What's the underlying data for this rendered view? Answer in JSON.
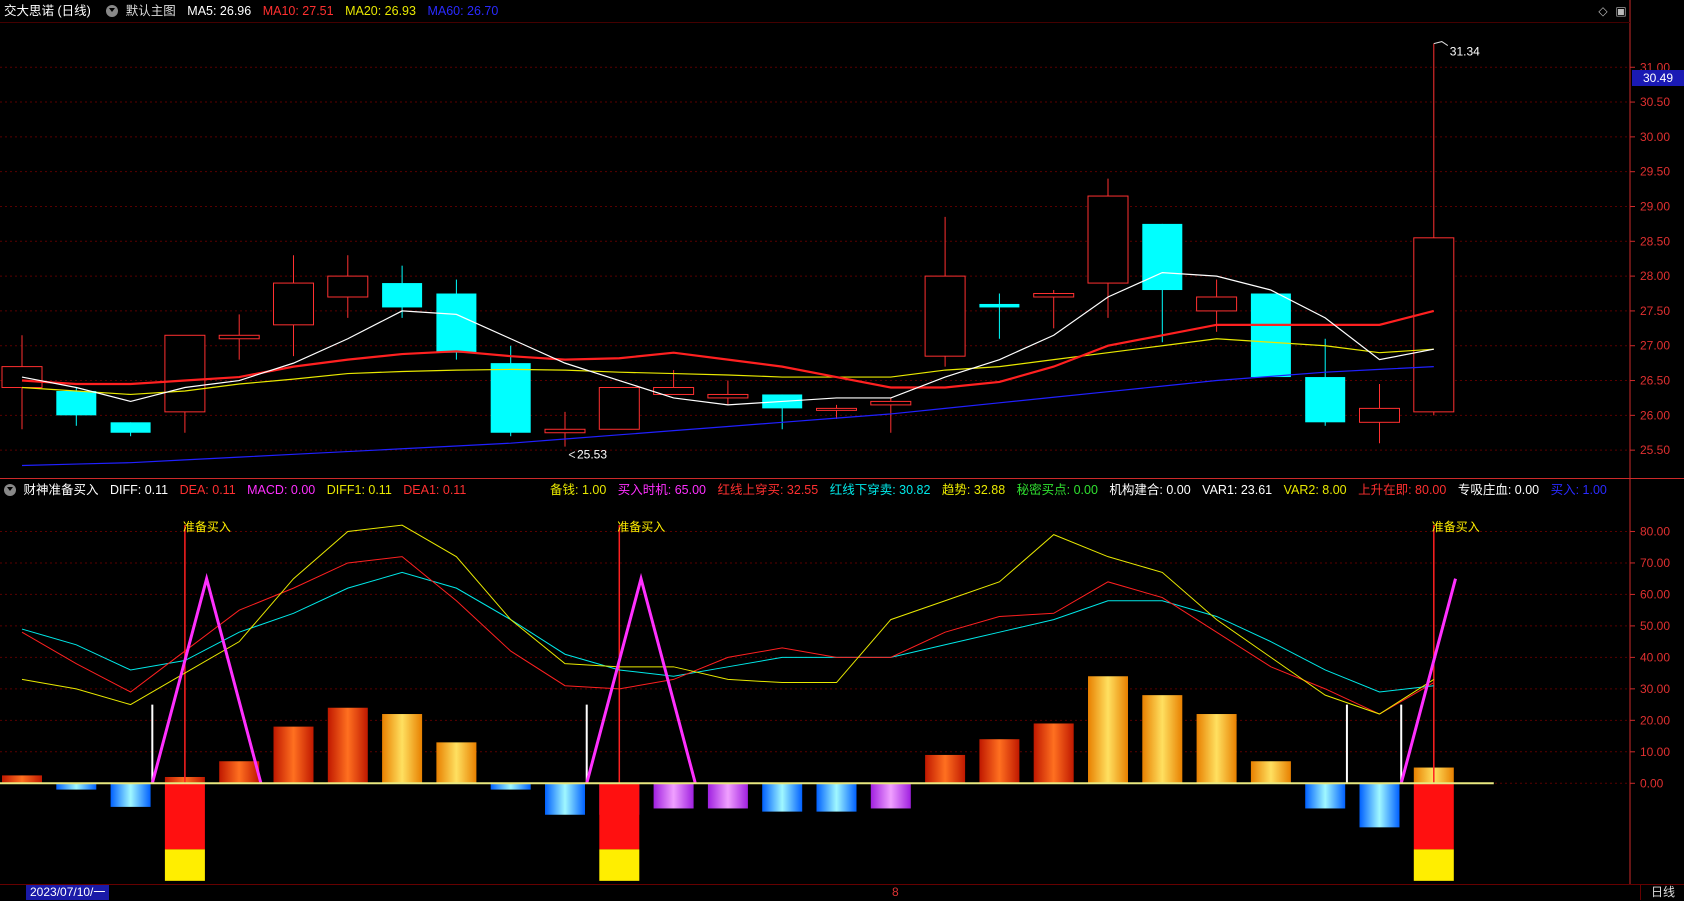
{
  "main_header": {
    "stock": "交大思诺 (日线)",
    "layout": "默认主图",
    "ma5": "MA5: 26.96",
    "ma10": "MA10: 27.51",
    "ma20": "MA20: 26.93",
    "ma60": "MA60: 26.70"
  },
  "indicator_header": {
    "name": "财神准备买入",
    "diff": "DIFF: 0.11",
    "dea": "DEA: 0.11",
    "macd": "MACD: 0.00",
    "diff1": "DIFF1: 0.11",
    "dea1": "DEA1: 0.11",
    "beiqian": "备钱: 1.00",
    "mairushiji": "买入时机: 65.00",
    "hongxian_shang": "红线上穿买: 32.55",
    "hongxian_xia": "红线下穿卖: 30.82",
    "qushi": "趋势: 32.88",
    "mimi": "秘密买点: 0.00",
    "jigou": "机构建合: 0.00",
    "var1": "VAR1: 23.61",
    "var2": "VAR2: 8.00",
    "shangsheng": "上升在即: 80.00",
    "zhuanxi": "专吸庄血: 0.00",
    "mairu": "买入: 1.00"
  },
  "colors": {
    "up": "#ff3030",
    "down": "#00ffff",
    "ma5": "#ffffff",
    "ma10": "#ff2020",
    "ma20": "#e8e800",
    "ma60": "#2020ff",
    "grid": "#5a0000",
    "axis": "#cc2a2a"
  },
  "price_axis": {
    "ticks": [
      "31.00",
      "30.50",
      "30.00",
      "29.50",
      "29.00",
      "28.50",
      "28.00",
      "27.50",
      "27.00",
      "26.50",
      "26.00",
      "25.50"
    ],
    "current": "30.49"
  },
  "indicator_axis": {
    "ticks": [
      "80.00",
      "70.00",
      "60.00",
      "50.00",
      "40.00",
      "30.00",
      "20.00",
      "10.00",
      "0.00"
    ]
  },
  "annotations": {
    "high": "31.34",
    "low": "25.53",
    "ready_buy": "准备买入",
    "caishen": "财神"
  },
  "bottom_bar": {
    "date": "2023/07/10/一",
    "month_mark": "8",
    "period": "日线"
  },
  "chart_data": {
    "type": "candlestick",
    "price_ylim": [
      25.1,
      31.65
    ],
    "candles": [
      {
        "o": 26.4,
        "c": 26.7,
        "h": 27.15,
        "l": 25.8
      },
      {
        "o": 26.35,
        "c": 26.0,
        "h": 26.4,
        "l": 25.85
      },
      {
        "o": 25.9,
        "c": 25.75,
        "h": 25.9,
        "l": 25.7
      },
      {
        "o": 26.05,
        "c": 27.15,
        "h": 27.15,
        "l": 25.75
      },
      {
        "o": 27.1,
        "c": 27.15,
        "h": 27.45,
        "l": 26.8
      },
      {
        "o": 27.3,
        "c": 27.9,
        "h": 28.3,
        "l": 26.85
      },
      {
        "o": 27.7,
        "c": 28.0,
        "h": 28.3,
        "l": 27.4
      },
      {
        "o": 27.9,
        "c": 27.55,
        "h": 28.15,
        "l": 27.4
      },
      {
        "o": 27.75,
        "c": 26.9,
        "h": 27.95,
        "l": 26.8
      },
      {
        "o": 26.75,
        "c": 25.75,
        "h": 27.0,
        "l": 25.7
      },
      {
        "o": 25.75,
        "c": 25.8,
        "h": 26.05,
        "l": 25.55
      },
      {
        "o": 25.8,
        "c": 26.4,
        "h": 26.4,
        "l": 25.8
      },
      {
        "o": 26.3,
        "c": 26.4,
        "h": 26.65,
        "l": 26.3
      },
      {
        "o": 26.25,
        "c": 26.3,
        "h": 26.5,
        "l": 26.15
      },
      {
        "o": 26.3,
        "c": 26.1,
        "h": 26.3,
        "l": 25.8
      },
      {
        "o": 26.1,
        "c": 26.1,
        "h": 26.15,
        "l": 25.95
      },
      {
        "o": 26.15,
        "c": 26.2,
        "h": 26.25,
        "l": 25.75
      },
      {
        "o": 26.85,
        "c": 28.0,
        "h": 28.85,
        "l": 26.7
      },
      {
        "o": 27.6,
        "c": 27.55,
        "h": 27.75,
        "l": 27.1
      },
      {
        "o": 27.7,
        "c": 27.75,
        "h": 27.8,
        "l": 27.25
      },
      {
        "o": 27.9,
        "c": 29.15,
        "h": 29.4,
        "l": 27.4
      },
      {
        "o": 28.75,
        "c": 27.8,
        "h": 28.75,
        "l": 27.05
      },
      {
        "o": 27.5,
        "c": 27.7,
        "h": 27.95,
        "l": 27.2
      },
      {
        "o": 27.75,
        "c": 26.55,
        "h": 27.75,
        "l": 26.55
      },
      {
        "o": 26.55,
        "c": 25.9,
        "h": 27.1,
        "l": 25.85
      },
      {
        "o": 25.9,
        "c": 26.1,
        "h": 26.45,
        "l": 25.6
      },
      {
        "o": 26.05,
        "c": 28.55,
        "h": 31.34,
        "l": 26.0
      }
    ],
    "ma5": [
      26.55,
      26.4,
      26.2,
      26.4,
      26.5,
      26.75,
      27.1,
      27.5,
      27.45,
      27.1,
      26.75,
      26.5,
      26.25,
      26.15,
      26.2,
      26.25,
      26.25,
      26.55,
      26.8,
      27.15,
      27.7,
      28.05,
      28.0,
      27.8,
      27.4,
      26.8,
      26.95
    ],
    "ma10": [
      26.5,
      26.45,
      26.45,
      26.5,
      26.55,
      26.7,
      26.8,
      26.88,
      26.92,
      26.85,
      26.8,
      26.82,
      26.9,
      26.8,
      26.7,
      26.55,
      26.4,
      26.4,
      26.48,
      26.7,
      27.0,
      27.15,
      27.3,
      27.3,
      27.3,
      27.3,
      27.5
    ],
    "ma20": [
      26.4,
      26.35,
      26.3,
      26.35,
      26.45,
      26.52,
      26.6,
      26.63,
      26.65,
      26.66,
      26.65,
      26.62,
      26.6,
      26.58,
      26.55,
      26.55,
      26.55,
      26.65,
      26.7,
      26.8,
      26.9,
      27.0,
      27.1,
      27.05,
      27.0,
      26.9,
      26.95
    ],
    "ma60": [
      25.28,
      25.3,
      25.32,
      25.36,
      25.4,
      25.44,
      25.48,
      25.52,
      25.56,
      25.6,
      25.66,
      25.72,
      25.78,
      25.84,
      25.9,
      25.96,
      26.02,
      26.1,
      26.18,
      26.26,
      26.34,
      26.42,
      26.5,
      26.56,
      26.62,
      26.66,
      26.7
    ],
    "indicator_ylim": [
      -32,
      90
    ],
    "yellow_line": [
      33,
      30,
      25,
      35,
      45,
      65,
      80,
      82,
      72,
      52,
      38,
      37,
      37,
      33,
      32,
      32,
      52,
      58,
      64,
      79,
      72,
      67,
      52,
      40,
      28,
      22,
      33
    ],
    "red_line": [
      48,
      38,
      29,
      42,
      55,
      62,
      70,
      72,
      58,
      42,
      31,
      30,
      33,
      40,
      43,
      40,
      40,
      48,
      53,
      54,
      64,
      59,
      48,
      37,
      30,
      22,
      32
    ],
    "cyan_line": [
      49,
      44,
      36,
      39,
      48,
      54,
      62,
      67,
      62,
      52,
      41,
      36,
      34,
      37,
      40,
      40,
      40,
      44,
      48,
      52,
      58,
      58,
      53,
      45,
      36,
      29,
      31
    ],
    "histogram": [
      2.5,
      -2,
      -7.5,
      2,
      7,
      18,
      24,
      22,
      13,
      -2,
      -10,
      -10,
      -8,
      -8,
      -9,
      -9,
      -8,
      9,
      14,
      19,
      34,
      28,
      22,
      7,
      -8,
      -14,
      5
    ],
    "magenta_zigzag": [
      [
        2.4,
        0
      ],
      [
        3.4,
        65
      ],
      [
        4.4,
        0
      ],
      null,
      [
        10.4,
        0
      ],
      [
        11.4,
        65
      ],
      [
        12.4,
        0
      ],
      null,
      [
        25.4,
        0
      ],
      [
        26.4,
        65
      ]
    ],
    "white_sticks": [
      [
        2.4,
        25
      ],
      [
        10.4,
        25
      ],
      [
        24.4,
        25
      ],
      [
        25.4,
        25
      ]
    ],
    "signal_index": [
      3,
      11,
      26
    ]
  }
}
